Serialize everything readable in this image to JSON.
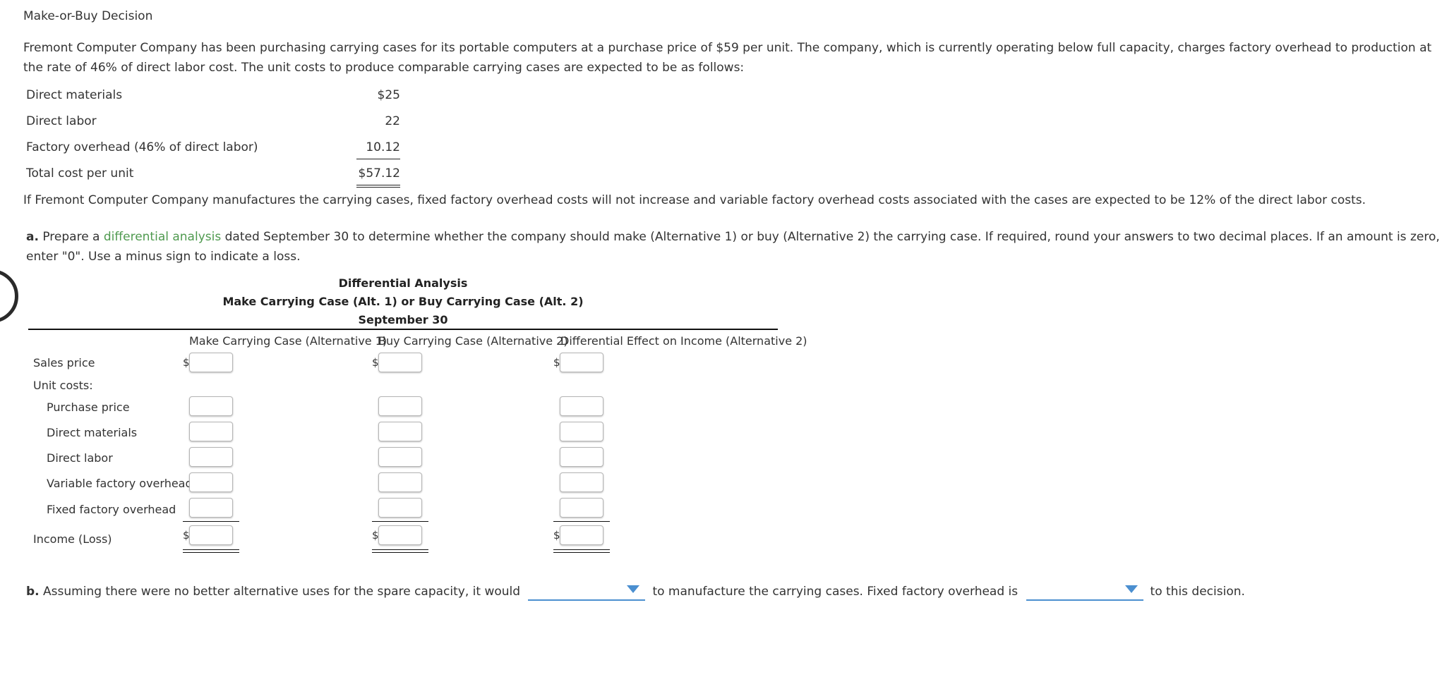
{
  "title": "Make-or-Buy Decision",
  "intro": "Fremont Computer Company has been purchasing carrying cases for its portable computers at a purchase price of $59 per unit. The company, which is currently operating below full capacity, charges factory overhead to production at the rate of 46% of direct labor cost. The unit costs to produce comparable carrying cases are expected to be as follows:",
  "unit_costs": [
    {
      "label": "Direct materials",
      "value": "$25"
    },
    {
      "label": "Direct labor",
      "value": "22"
    },
    {
      "label": "Factory overhead (46% of direct labor)",
      "value": "10.12"
    },
    {
      "label": "Total cost per unit",
      "value": "$57.12"
    }
  ],
  "note": "If Fremont Computer Company manufactures the carrying cases, fixed factory overhead costs will not increase and variable factory overhead costs associated with the cases are expected to be 12% of the direct labor costs.",
  "part_a": {
    "letter": "a.",
    "before_link": " Prepare a ",
    "link": "differential analysis",
    "after_link": " dated September 30 to determine whether the company should make (Alternative 1) or buy (Alternative 2) the carrying case. If required, round your answers to two decimal places. If an amount is zero, enter \"0\". Use a minus sign to indicate a loss."
  },
  "analysis": {
    "heading1": "Differential Analysis",
    "heading2": "Make Carrying Case (Alt. 1) or Buy Carrying Case (Alt. 2)",
    "heading3": "September 30",
    "columns": [
      "Make Carrying Case (Alternative 1)",
      "Buy Carrying Case (Alternative 2)",
      "Differential Effect on Income (Alternative 2)"
    ],
    "currency_symbol": "$",
    "rows": {
      "sales_price": "Sales price",
      "unit_costs": "Unit costs:",
      "purchase_price": "Purchase price",
      "direct_materials": "Direct materials",
      "direct_labor": "Direct labor",
      "variable_overhead": "Variable factory overhead",
      "fixed_overhead": "Fixed factory overhead",
      "income": "Income (Loss)"
    },
    "values": {
      "sales_price": [
        "",
        "",
        ""
      ],
      "purchase_price": [
        "",
        "",
        ""
      ],
      "direct_materials": [
        "",
        "",
        ""
      ],
      "direct_labor": [
        "",
        "",
        ""
      ],
      "variable_overhead": [
        "",
        "",
        ""
      ],
      "fixed_overhead": [
        "",
        "",
        ""
      ],
      "income": [
        "",
        "",
        ""
      ]
    }
  },
  "part_b": {
    "letter": "b.",
    "text1": " Assuming there were no better alternative uses for the spare capacity, it would",
    "dropdown1_value": "",
    "text2": "to manufacture the carrying cases. Fixed factory overhead is",
    "dropdown2_value": "",
    "text3": "to this decision."
  },
  "colors": {
    "link_green": "#4f9a4f",
    "dropdown_blue": "#4b8fd0"
  }
}
